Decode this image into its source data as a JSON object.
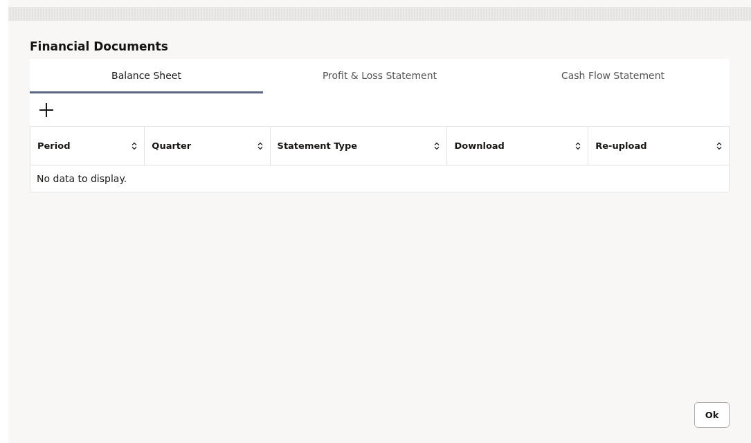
{
  "title": "Financial Documents",
  "tabs": [
    {
      "label": "Balance Sheet",
      "selected": true
    },
    {
      "label": "Profit & Loss Statement",
      "selected": false
    },
    {
      "label": "Cash Flow Statement",
      "selected": false
    }
  ],
  "table": {
    "columns": [
      "Period",
      "Quarter",
      "Statement Type",
      "Download",
      "Re-upload"
    ],
    "empty_message": "No data to display."
  },
  "buttons": [
    "Ok"
  ]
}
